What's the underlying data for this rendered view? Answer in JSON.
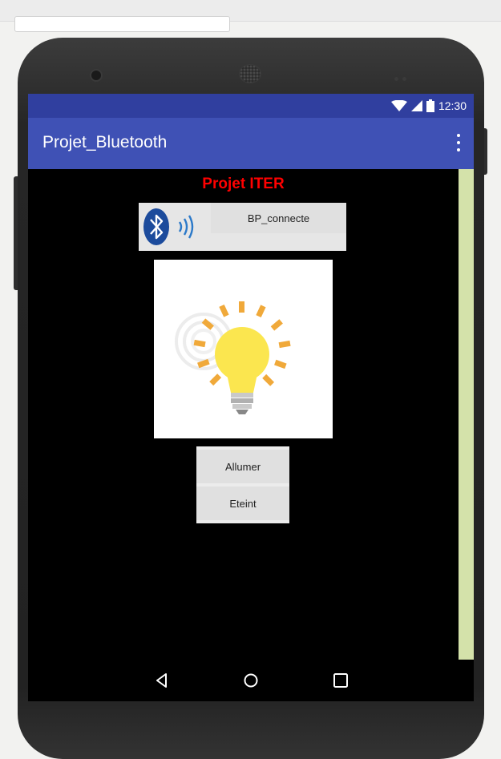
{
  "status_bar": {
    "time": "12:30",
    "icons": [
      "wifi-icon",
      "signal-icon",
      "battery-icon"
    ]
  },
  "app_bar": {
    "title": "Projet_Bluetooth",
    "menu_icon": "more-vert-icon"
  },
  "screen": {
    "heading": "Projet ITER",
    "heading_color": "#ff0000",
    "bluetooth_icon": "bluetooth-icon",
    "connect_button_label": "BP_connecte",
    "image_icon": "light-bulb-icon",
    "buttons": [
      "Allumer",
      "Eteint"
    ]
  },
  "nav_bar": {
    "icons": [
      "back-icon",
      "home-icon",
      "recents-icon"
    ]
  },
  "colors": {
    "status_bar": "#303f9f",
    "app_bar": "#3f51b5",
    "scroll_track": "#d4e2aa",
    "screen_bg": "#000000"
  }
}
